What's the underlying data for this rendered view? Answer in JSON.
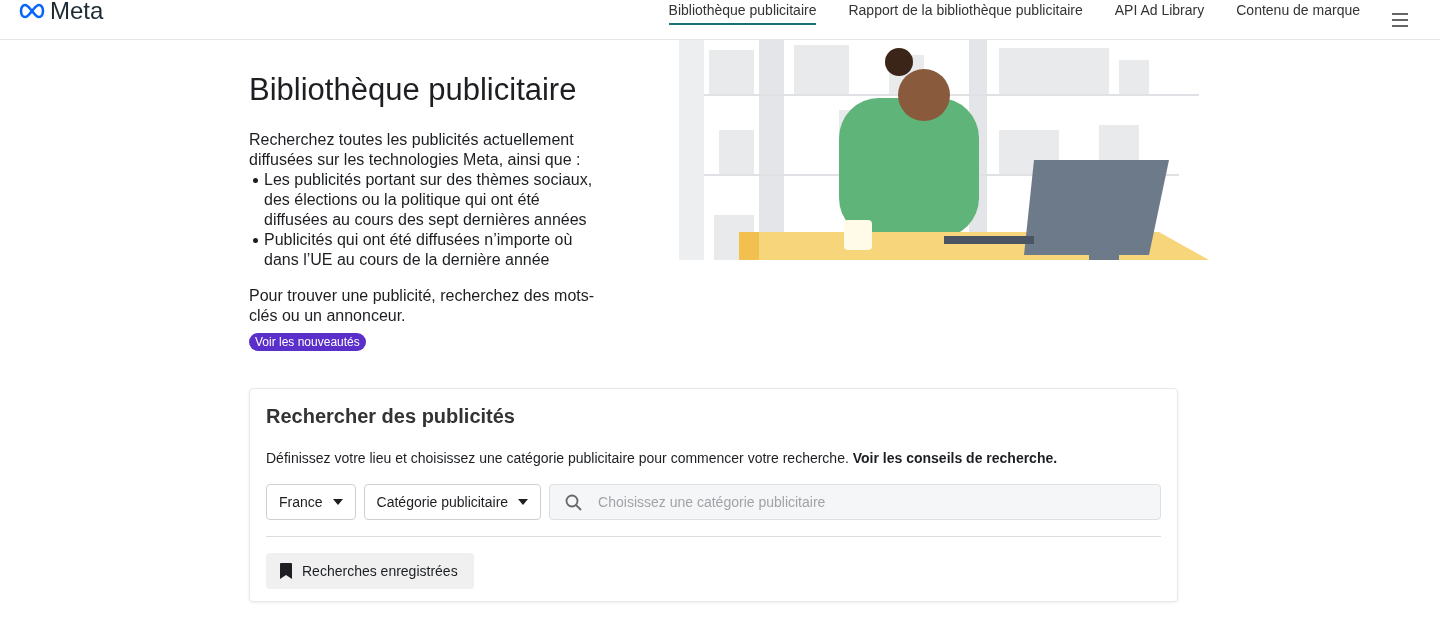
{
  "header": {
    "logo_text": "Meta",
    "nav": [
      {
        "label": "Bibliothèque publicitaire",
        "selected": true
      },
      {
        "label": "Rapport de la bibliothèque publicitaire",
        "selected": false
      },
      {
        "label": "API Ad Library",
        "selected": false
      },
      {
        "label": "Contenu de marque",
        "selected": false
      }
    ]
  },
  "hero": {
    "title": "Bibliothèque publicitaire",
    "intro": "Recherchez toutes les publicités actuellement diffusées sur les technologies Meta, ainsi que :",
    "bullets": [
      "Les publicités portant sur des thèmes sociaux, des élections ou la politique qui ont été diffusées au cours des sept dernières années",
      "Publicités qui ont été diffusées n’importe où dans l’UE au cours de la dernière année"
    ],
    "hint": "Pour trouver une publicité, recherchez des mots-clés ou un annonceur.",
    "badge": "Voir les nouveautés"
  },
  "search_card": {
    "title": "Rechercher des publicités",
    "description": "Définissez votre lieu et choisissez une catégorie publicitaire pour commencer votre recherche.",
    "link": "Voir les conseils de recherche.",
    "dropdowns": [
      "France",
      "Catégorie publicitaire"
    ],
    "search": {
      "placeholder": "Choisissez une catégorie publicitaire"
    },
    "saved_button": "Recherches enregistrées"
  }
}
